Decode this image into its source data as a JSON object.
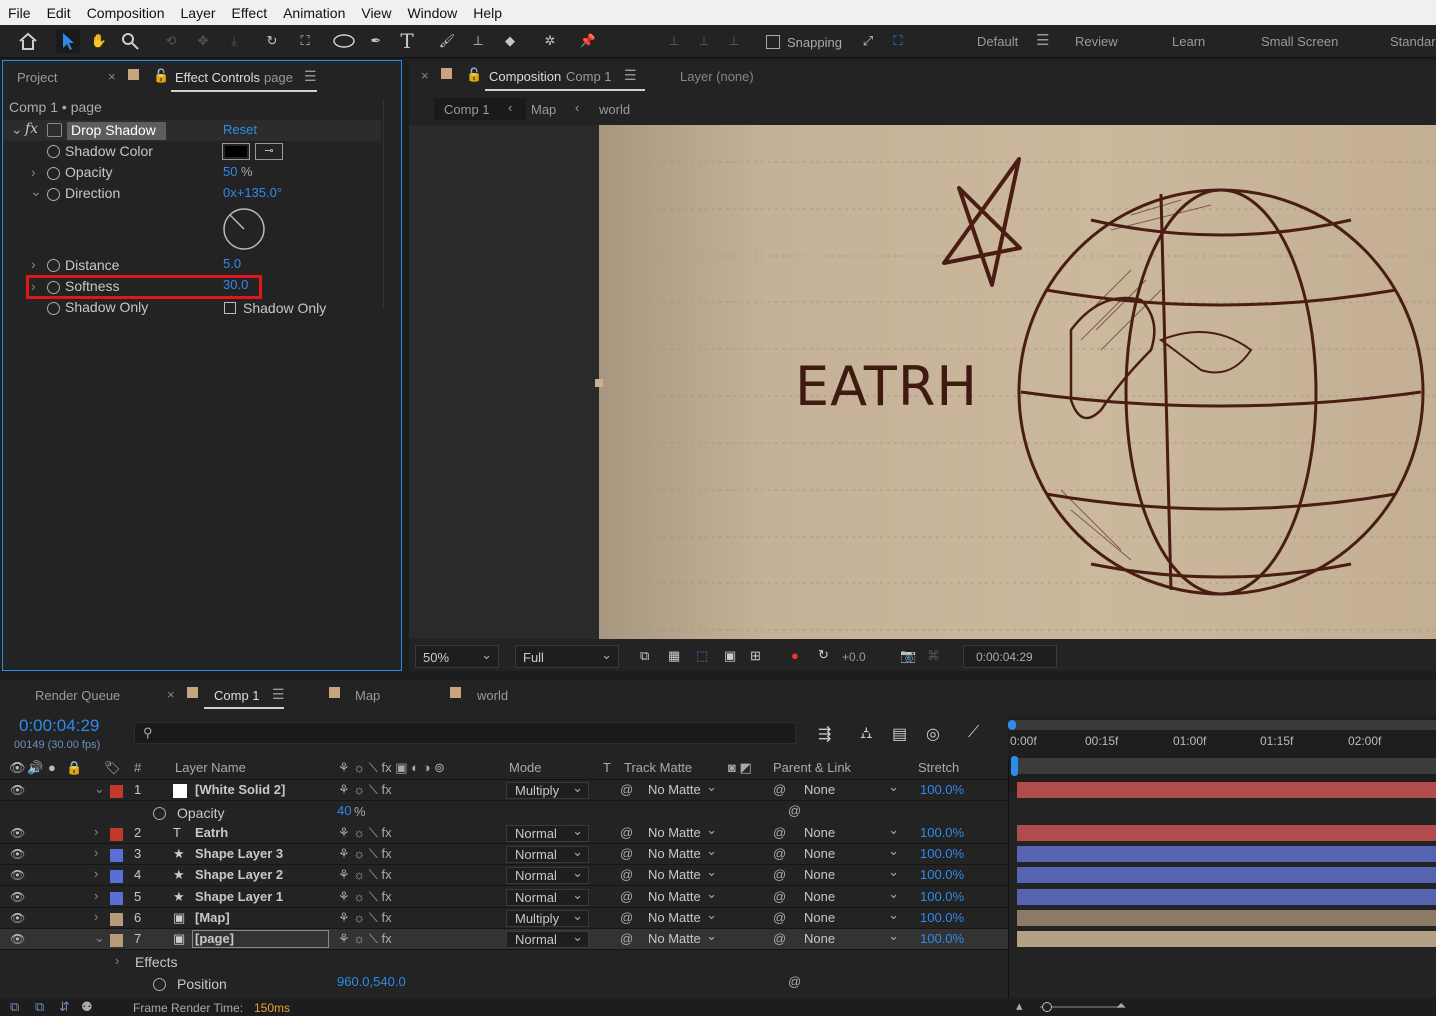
{
  "menu": [
    "File",
    "Edit",
    "Composition",
    "Layer",
    "Effect",
    "Animation",
    "View",
    "Window",
    "Help"
  ],
  "toolbar": {
    "snapping": "Snapping",
    "workspaces": [
      "Default",
      "Review",
      "Learn",
      "Small Screen",
      "Standar"
    ]
  },
  "left_panel": {
    "tab_project": "Project",
    "tab_effect_controls": "Effect Controls",
    "tab_effect_target": "page",
    "breadcrumb": "Comp 1 • page",
    "effect_name": "Drop Shadow",
    "reset": "Reset",
    "props": {
      "shadow_color": "Shadow Color",
      "opacity": "Opacity",
      "opacity_val": "50",
      "opacity_unit": "%",
      "direction": "Direction",
      "direction_val": "0x+135.0°",
      "distance": "Distance",
      "distance_val": "5.0",
      "softness": "Softness",
      "softness_val": "30.0",
      "shadow_only": "Shadow Only",
      "shadow_only_cb": "Shadow Only"
    },
    "shadow_color_hex": "#000000",
    "highlight_color": "#e0161b"
  },
  "comp_panel": {
    "tab_label": "Composition",
    "tab_comp": "Comp 1",
    "layer_tab": "Layer (none)",
    "crumbs": [
      "Comp 1",
      "Map",
      "world"
    ],
    "canvas_text": "EATRH",
    "zoom": "50%",
    "resolution": "Full",
    "exposure": "+0.0",
    "timecode": "0:00:04:29"
  },
  "timeline": {
    "tabs": [
      "Render Queue",
      "Comp 1",
      "Map",
      "world"
    ],
    "timecode": "0:00:04:29",
    "frames": "00149 (30.00 fps)",
    "ruler": [
      "0:00f",
      "00:15f",
      "01:00f",
      "01:15f",
      "02:00f"
    ],
    "headers": {
      "hash": "#",
      "layer_name": "Layer Name",
      "mode": "Mode",
      "t": "T",
      "track_matte": "Track Matte",
      "parent": "Parent & Link",
      "stretch": "Stretch"
    },
    "layers": [
      {
        "num": "1",
        "name": "[White Solid 2]",
        "mode": "Multiply",
        "matte": "No Matte",
        "parent": "None",
        "stretch": "100.0%",
        "label": "#c0392b",
        "bar": "#b14c4c",
        "type": "solid",
        "expanded": true
      },
      {
        "num": "2",
        "name": "Eatrh",
        "mode": "Normal",
        "matte": "No Matte",
        "parent": "None",
        "stretch": "100.0%",
        "label": "#c0392b",
        "bar": "#b14c4c",
        "type": "text"
      },
      {
        "num": "3",
        "name": "Shape Layer 3",
        "mode": "Normal",
        "matte": "No Matte",
        "parent": "None",
        "stretch": "100.0%",
        "label": "#5a6fd6",
        "bar": "#5563b0",
        "type": "shape"
      },
      {
        "num": "4",
        "name": "Shape Layer 2",
        "mode": "Normal",
        "matte": "No Matte",
        "parent": "None",
        "stretch": "100.0%",
        "label": "#5a6fd6",
        "bar": "#5563b0",
        "type": "shape"
      },
      {
        "num": "5",
        "name": "Shape Layer 1",
        "mode": "Normal",
        "matte": "No Matte",
        "parent": "None",
        "stretch": "100.0%",
        "label": "#5a6fd6",
        "bar": "#5563b0",
        "type": "shape"
      },
      {
        "num": "6",
        "name": "[Map]",
        "mode": "Multiply",
        "matte": "No Matte",
        "parent": "None",
        "stretch": "100.0%",
        "label": "#b89a78",
        "bar": "#8c7a66",
        "type": "comp"
      },
      {
        "num": "7",
        "name": "[page]",
        "mode": "Normal",
        "matte": "No Matte",
        "parent": "None",
        "stretch": "100.0%",
        "label": "#b89a78",
        "bar": "#b4a084",
        "type": "comp",
        "expanded": true
      }
    ],
    "opacity_label": "Opacity",
    "opacity_val": "40",
    "opacity_unit": "%",
    "effects_label": "Effects",
    "position_label": "Position",
    "position_val": "960.0,540.0",
    "footer": "Frame Render Time:",
    "render_time": "150ms"
  }
}
